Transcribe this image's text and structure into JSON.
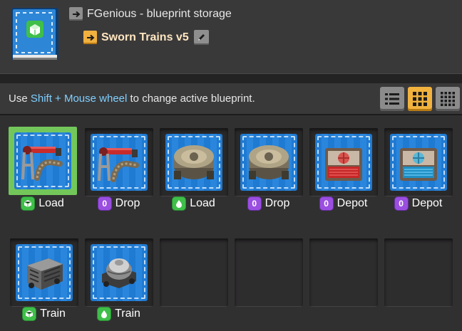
{
  "header": {
    "book_icon": "blueprint-book-icon",
    "parent_arrow_icon": "arrow-right-icon",
    "parent_title": "FGenious - blueprint storage",
    "current_arrow_icon": "arrow-right-icon",
    "current_title": "Sworn Trains v5",
    "edit_icon": "pencil-icon"
  },
  "toolbar": {
    "hint_prefix": "Use ",
    "hint_highlight": "Shift + Mouse wheel",
    "hint_suffix": " to change active blueprint.",
    "view_buttons": [
      {
        "icon": "list-view-icon",
        "active": false
      },
      {
        "icon": "grid-view-icon",
        "active": true
      },
      {
        "icon": "small-grid-view-icon",
        "active": false
      }
    ]
  },
  "slots": [
    {
      "label": "Load",
      "badge": "green",
      "badge_icon": "cube-icon",
      "object": "inserter-icon",
      "selected": true
    },
    {
      "label": "Drop",
      "badge": "purple",
      "badge_text": "0",
      "object": "inserter-icon",
      "selected": false
    },
    {
      "label": "Load",
      "badge": "green",
      "badge_icon": "fluid-drop-icon",
      "object": "storage-tank-icon",
      "selected": false
    },
    {
      "label": "Drop",
      "badge": "purple",
      "badge_text": "0",
      "object": "storage-tank-icon",
      "selected": false
    },
    {
      "label": "Depot",
      "badge": "purple",
      "badge_text": "0",
      "object": "red-depot-icon",
      "selected": false
    },
    {
      "label": "Depot",
      "badge": "purple",
      "badge_text": "0",
      "object": "blue-depot-icon",
      "selected": false
    },
    {
      "label": "Train",
      "badge": "green",
      "badge_icon": "cube-icon",
      "object": "cargo-wagon-icon",
      "selected": false
    },
    {
      "label": "Train",
      "badge": "green",
      "badge_icon": "fluid-drop-icon",
      "object": "fluid-wagon-icon",
      "selected": false
    }
  ],
  "colors": {
    "accent_orange": "#f2b33e",
    "hint_blue": "#7fd0ff",
    "title_cream": "#ffe6c0",
    "badge_green": "#3fbf49",
    "badge_purple": "#9a4fe0",
    "selected_green": "#73c75a"
  }
}
